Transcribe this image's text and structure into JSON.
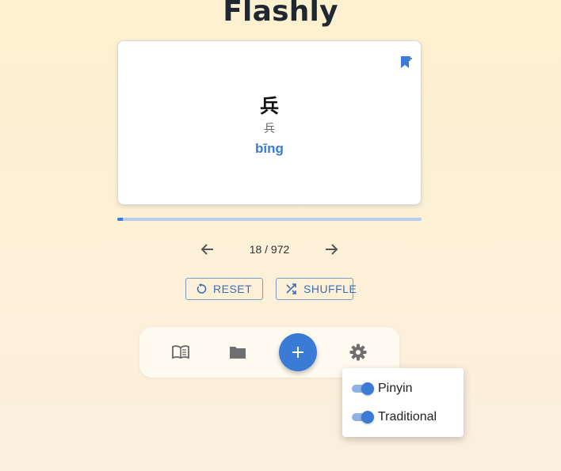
{
  "app": {
    "title": "Flashly"
  },
  "card": {
    "character": "兵",
    "traditional": "兵",
    "pinyin": "bīng",
    "bookmark_icon": "bookmark-add-icon"
  },
  "progress": {
    "current": 18,
    "total": 972,
    "fraction": 0.0185,
    "label": "18 / 972"
  },
  "navigation": {
    "prev_icon": "arrow-left-icon",
    "next_icon": "arrow-right-icon"
  },
  "actions": {
    "reset_label": "RESET",
    "reset_icon": "reset-icon",
    "shuffle_label": "SHUFFLE",
    "shuffle_icon": "shuffle-icon"
  },
  "toolbar": {
    "items": [
      "book-icon",
      "folder-icon",
      "add-icon",
      "gear-icon"
    ]
  },
  "settings_menu": {
    "items": [
      {
        "label": "Pinyin",
        "enabled": true
      },
      {
        "label": "Traditional",
        "enabled": true
      }
    ]
  },
  "colors": {
    "accent": "#3a7bd5",
    "title": "#1f2733",
    "background": "#fdf1cf"
  }
}
